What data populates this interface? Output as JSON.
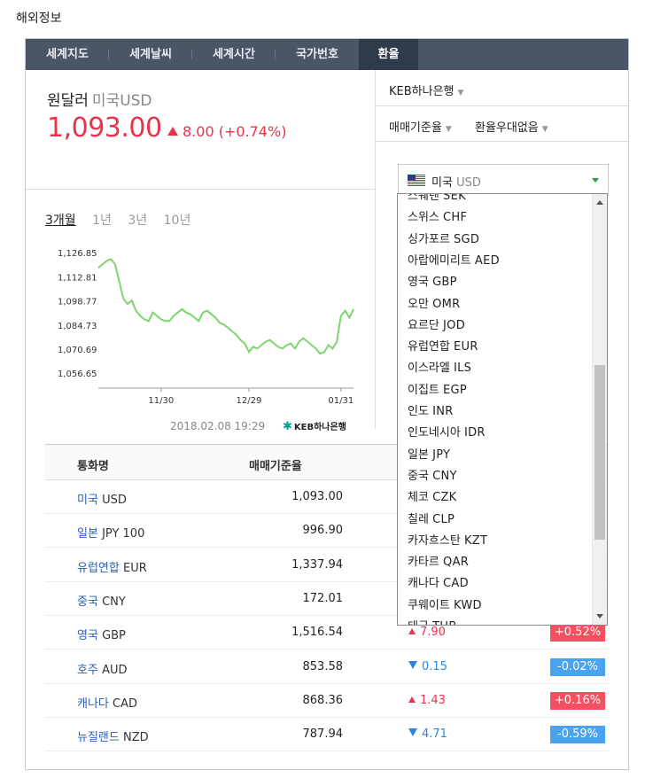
{
  "page_title": "해외정보",
  "tabs": [
    {
      "label": "세계지도",
      "active": false
    },
    {
      "label": "세계날씨",
      "active": false
    },
    {
      "label": "세계시간",
      "active": false
    },
    {
      "label": "국가번호",
      "active": false
    },
    {
      "label": "환율",
      "active": true
    }
  ],
  "summary": {
    "pair_name": "원달러",
    "pair_sub": "미국USD",
    "rate": "1,093.00",
    "change": "8.00 (+0.74%)",
    "direction": "up"
  },
  "periods": [
    {
      "label": "3개월",
      "active": true
    },
    {
      "label": "1년",
      "active": false
    },
    {
      "label": "3년",
      "active": false
    },
    {
      "label": "10년",
      "active": false
    }
  ],
  "chart_data": {
    "type": "line",
    "title": "",
    "xlabel": "",
    "ylabel": "",
    "y_ticks": [
      "1,126.85",
      "1,112.81",
      "1,098.77",
      "1,084.73",
      "1,070.69",
      "1,056.65"
    ],
    "y_tick_values": [
      1126.85,
      1112.81,
      1098.77,
      1084.73,
      1070.69,
      1056.65
    ],
    "x_ticks": [
      "11/30",
      "12/29",
      "01/31"
    ],
    "x_tick_index": [
      15,
      36,
      58
    ],
    "ylim": [
      1048,
      1131
    ],
    "grid": false,
    "line_color": "#7dd66b",
    "series": [
      {
        "values": [
          1118,
          1120,
          1122,
          1123,
          1120,
          1110,
          1100,
          1097,
          1099,
          1093,
          1090,
          1088,
          1087,
          1092,
          1090,
          1088,
          1087,
          1087,
          1090,
          1092,
          1094,
          1092,
          1091,
          1089,
          1087,
          1092,
          1093,
          1091,
          1089,
          1086,
          1085,
          1083,
          1081,
          1079,
          1076,
          1074,
          1069,
          1072,
          1071,
          1073,
          1075,
          1076,
          1074,
          1072,
          1071,
          1073,
          1074,
          1071,
          1075,
          1077,
          1075,
          1073,
          1071,
          1068,
          1069,
          1073,
          1071,
          1075,
          1090,
          1093,
          1089,
          1094
        ]
      }
    ]
  },
  "timestamp": "2018.02.08 19:29",
  "brand": "KEB하나은행",
  "right_panel": {
    "bank_select": "KEB하나은행",
    "rate_type_select": "매매기준율",
    "favor_select": "환율우대없음",
    "currency_select": {
      "country": "미국",
      "code": "USD"
    }
  },
  "dropdown_items": [
    {
      "country": "스웨덴",
      "code": "SEK"
    },
    {
      "country": "스위스",
      "code": "CHF"
    },
    {
      "country": "싱가포르",
      "code": "SGD"
    },
    {
      "country": "아랍에미리트",
      "code": "AED"
    },
    {
      "country": "영국",
      "code": "GBP"
    },
    {
      "country": "오만",
      "code": "OMR"
    },
    {
      "country": "요르단",
      "code": "JOD"
    },
    {
      "country": "유럽연합",
      "code": "EUR"
    },
    {
      "country": "이스라엘",
      "code": "ILS"
    },
    {
      "country": "이집트",
      "code": "EGP"
    },
    {
      "country": "인도",
      "code": "INR"
    },
    {
      "country": "인도네시아",
      "code": "IDR"
    },
    {
      "country": "일본",
      "code": "JPY"
    },
    {
      "country": "중국",
      "code": "CNY"
    },
    {
      "country": "체코",
      "code": "CZK"
    },
    {
      "country": "칠레",
      "code": "CLP"
    },
    {
      "country": "카자흐스탄",
      "code": "KZT"
    },
    {
      "country": "카타르",
      "code": "QAR"
    },
    {
      "country": "캐나다",
      "code": "CAD"
    },
    {
      "country": "쿠웨이트",
      "code": "KWD"
    },
    {
      "country": "태국",
      "code": "THB"
    }
  ],
  "table": {
    "headers": [
      "통화명",
      "매매기준율"
    ],
    "rows": [
      {
        "country": "미국",
        "code": "USD",
        "rate": "1,093.00",
        "change": "",
        "percent": "",
        "dir": ""
      },
      {
        "country": "일본",
        "code": "JPY 100",
        "rate": "996.90",
        "change": "",
        "percent": "",
        "dir": ""
      },
      {
        "country": "유럽연합",
        "code": "EUR",
        "rate": "1,337.94",
        "change": "",
        "percent": "",
        "dir": ""
      },
      {
        "country": "중국",
        "code": "CNY",
        "rate": "172.01",
        "change": "",
        "percent": "",
        "dir": ""
      },
      {
        "country": "영국",
        "code": "GBP",
        "rate": "1,516.54",
        "change": "7.90",
        "percent": "+0.52%",
        "dir": "up"
      },
      {
        "country": "호주",
        "code": "AUD",
        "rate": "853.58",
        "change": "0.15",
        "percent": "-0.02%",
        "dir": "down"
      },
      {
        "country": "캐나다",
        "code": "CAD",
        "rate": "868.36",
        "change": "1.43",
        "percent": "+0.16%",
        "dir": "up"
      },
      {
        "country": "뉴질랜드",
        "code": "NZD",
        "rate": "787.94",
        "change": "4.71",
        "percent": "-0.59%",
        "dir": "down"
      }
    ]
  }
}
